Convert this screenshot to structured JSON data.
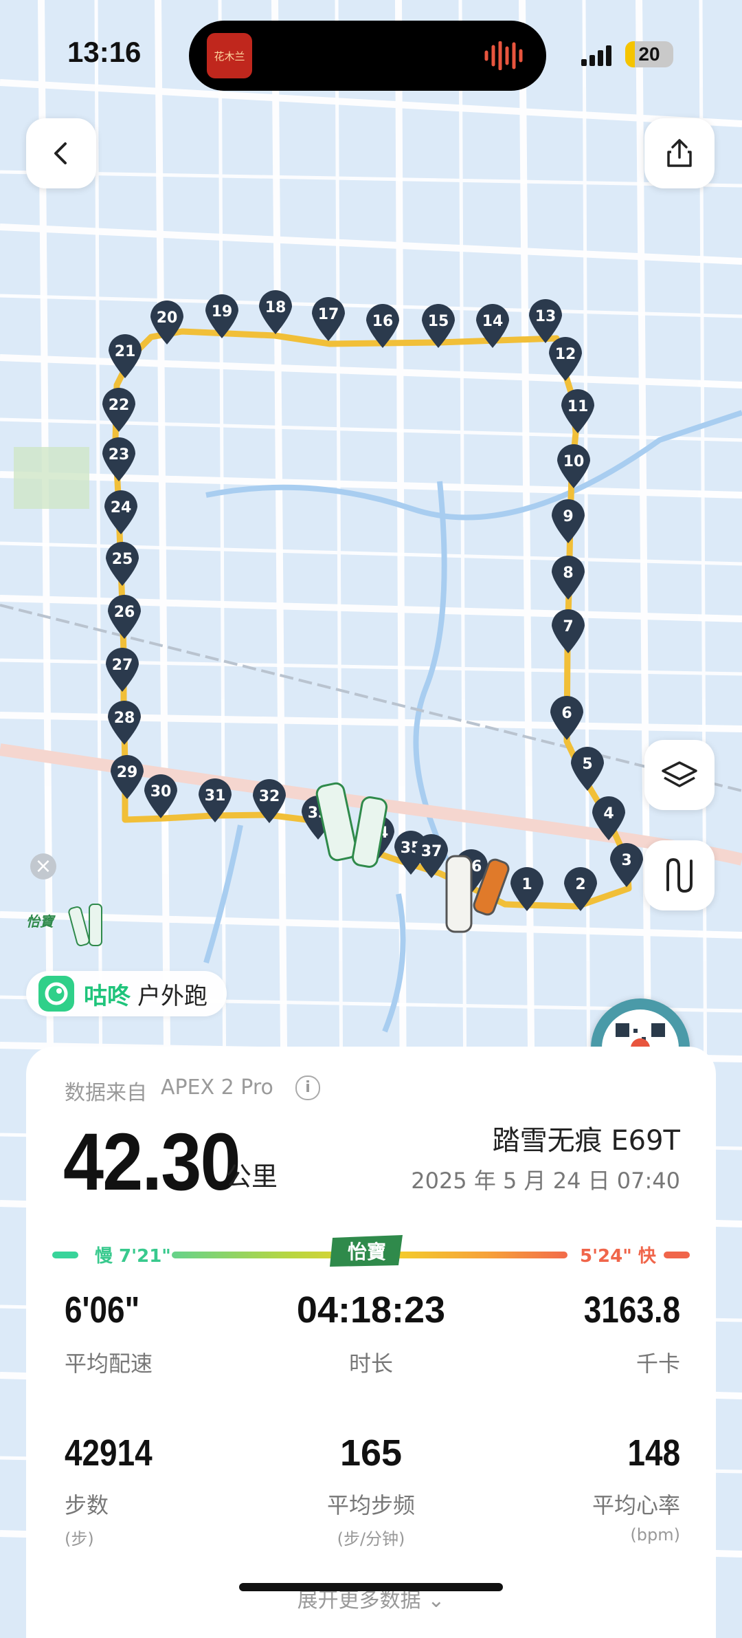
{
  "status_bar": {
    "time": "13:16",
    "battery": "20",
    "album_art_text": "花木兰"
  },
  "nav": {
    "back_icon": "chevron-left-icon",
    "share_icon": "share-icon"
  },
  "map": {
    "colors": {
      "route_start": "#f5d23a",
      "route_mid": "#f3b93a",
      "route_slow": "#f3a536",
      "marker": "#2b3a4d"
    },
    "km_markers": [
      "1",
      "2",
      "3",
      "4",
      "5",
      "6",
      "7",
      "8",
      "9",
      "10",
      "11",
      "12",
      "13",
      "14",
      "15",
      "16",
      "17",
      "18",
      "19",
      "20",
      "21",
      "22",
      "23",
      "24",
      "25",
      "26",
      "27",
      "28",
      "29",
      "30",
      "31",
      "32",
      "33",
      "34",
      "35",
      "36",
      "37"
    ],
    "controls": {
      "layers_icon": "layers-icon",
      "route_icon": "route-toggle-icon",
      "close_icon": "close-icon"
    }
  },
  "brand": {
    "name": "咕咚",
    "activity_type": "户外跑"
  },
  "card": {
    "source_label": "数据来自",
    "source_device": "APEX 2 Pro",
    "distance": "42.30",
    "distance_unit": "公里",
    "shoe": "踏雪无痕 E69T",
    "date": "2025 年 5 月 24 日 07:40",
    "pace_scale": {
      "slow": "慢 7'21\"",
      "fast": "5'24\" 快",
      "sponsor": "怡寶"
    },
    "stats": [
      {
        "value": "6'06\"",
        "label": "平均配速",
        "sub": ""
      },
      {
        "value": "04:18:23",
        "label": "时长",
        "sub": ""
      },
      {
        "value": "3163.8",
        "label": "千卡",
        "sub": ""
      },
      {
        "value": "42914",
        "label": "步数",
        "sub": "(步)"
      },
      {
        "value": "165",
        "label": "平均步频",
        "sub": "(步/分钟)"
      },
      {
        "value": "148",
        "label": "平均心率",
        "sub": "(bpm)"
      }
    ],
    "expand": "展开更多数据"
  }
}
